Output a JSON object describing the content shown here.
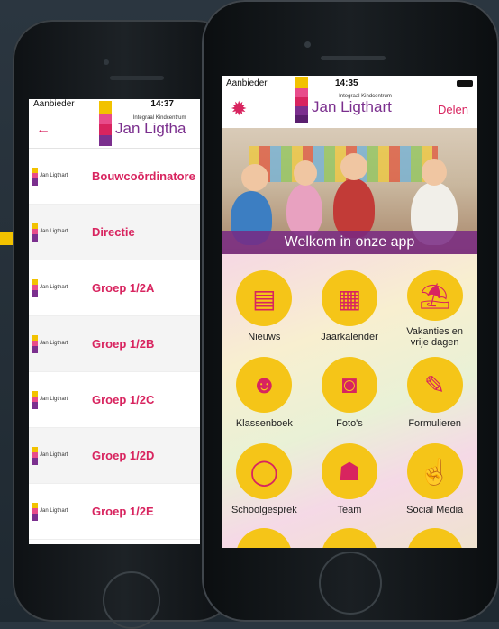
{
  "back_screen": {
    "status": {
      "carrier": "Aanbieder",
      "time": "14:37"
    },
    "header": {
      "logo_small": "Integraal Kindcentrum",
      "logo_big": "Jan Ligtha"
    },
    "items": [
      {
        "label": "Bouwcoördinatore"
      },
      {
        "label": "Directie"
      },
      {
        "label": "Groep 1/2A"
      },
      {
        "label": "Groep 1/2B"
      },
      {
        "label": "Groep 1/2C"
      },
      {
        "label": "Groep 1/2D"
      },
      {
        "label": "Groep 1/2E"
      }
    ],
    "item_logo_text": "Jan Ligthart"
  },
  "front_screen": {
    "status": {
      "carrier": "Aanbieder",
      "time": "14:35"
    },
    "header": {
      "logo_small": "Integraal Kindcentrum",
      "logo_big": "Jan Ligthart",
      "share": "Delen"
    },
    "banner": "Welkom in onze app",
    "tiles": [
      {
        "label": "Nieuws",
        "icon": "newspaper-icon"
      },
      {
        "label": "Jaarkalender",
        "icon": "calendar-icon"
      },
      {
        "label": "Vakanties en vrije dagen",
        "icon": "beach-icon"
      },
      {
        "label": "Klassenboek",
        "icon": "reader-icon"
      },
      {
        "label": "Foto's",
        "icon": "camera-icon"
      },
      {
        "label": "Formulieren",
        "icon": "form-icon"
      },
      {
        "label": "Schoolgesprek",
        "icon": "speech-bubble-icon"
      },
      {
        "label": "Team",
        "icon": "team-icon"
      },
      {
        "label": "Social Media",
        "icon": "social-media-icon"
      }
    ]
  },
  "colors": {
    "accent": "#d8245f",
    "tile": "#f5c518",
    "banner": "#7b2f8e"
  }
}
